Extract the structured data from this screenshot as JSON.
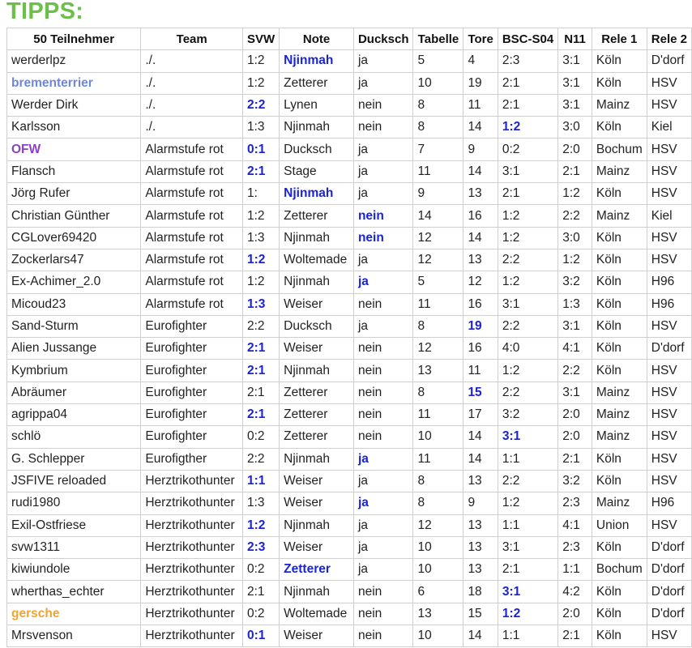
{
  "page": {
    "title": "TIPPS:",
    "title_color": "#6cc04a"
  },
  "highlight_color": "#1a23d6",
  "table": {
    "headers": [
      "50 Teilnehmer",
      "Team",
      "SVW",
      "Note",
      "Ducksch",
      "Tabelle",
      "Tore",
      "BSC-S04",
      "N11",
      "Rele 1",
      "Rele 2"
    ],
    "rows": [
      {
        "cells": [
          "werderlpz",
          "./.",
          "1:2",
          "Njinmah",
          "ja",
          "5",
          "4",
          "2:3",
          "3:1",
          "Köln",
          "D'dorf"
        ],
        "hl": [
          3
        ]
      },
      {
        "cells": [
          "brementerrier",
          "./.",
          "1:2",
          "Zetterer",
          "ja",
          "10",
          "19",
          "2:1",
          "3:1",
          "Köln",
          "HSV"
        ],
        "hl": [],
        "name_color": "#6f86e0",
        "name_bold": true
      },
      {
        "cells": [
          "Werder Dirk",
          "./.",
          "2:2",
          "Lynen",
          "nein",
          "8",
          "11",
          "2:1",
          "3:1",
          "Mainz",
          "HSV"
        ],
        "hl": [
          2
        ]
      },
      {
        "cells": [
          "Karlsson",
          "./.",
          "1:3",
          "Njinmah",
          "nein",
          "8",
          "14",
          "1:2",
          "3:0",
          "Köln",
          "Kiel"
        ],
        "hl": [
          7
        ]
      },
      {
        "cells": [
          "OFW",
          "Alarmstufe rot",
          "0:1",
          "Ducksch",
          "ja",
          "7",
          "9",
          "0:2",
          "2:0",
          "Bochum",
          "HSV"
        ],
        "hl": [
          2
        ],
        "name_color": "#8a3fc7",
        "name_bold": true
      },
      {
        "cells": [
          "Flansch",
          "Alarmstufe rot",
          "2:1",
          "Stage",
          "ja",
          "11",
          "14",
          "3:1",
          "2:1",
          "Mainz",
          "HSV"
        ],
        "hl": [
          2
        ]
      },
      {
        "cells": [
          "Jörg Rufer",
          "Alarmstufe rot",
          "1:",
          "Njinmah",
          "ja",
          "9",
          "13",
          "2:1",
          "1:2",
          "Köln",
          "HSV"
        ],
        "hl": [
          3
        ]
      },
      {
        "cells": [
          "Christian Günther",
          "Alarmstufe rot",
          "1:2",
          "Zetterer",
          "nein",
          "14",
          "16",
          "1:2",
          "2:2",
          "Mainz",
          "Kiel"
        ],
        "hl": [
          4
        ]
      },
      {
        "cells": [
          "CGLover69420",
          "Alarmstufe rot",
          "1:3",
          "Njinmah",
          "nein",
          "12",
          "14",
          "1:2",
          "3:0",
          "Köln",
          "HSV"
        ],
        "hl": [
          4
        ]
      },
      {
        "cells": [
          "Zockerlars47",
          "Alarmstufe rot",
          "1:2",
          "Woltemade",
          "ja",
          "12",
          "13",
          "2:2",
          "1:2",
          "Köln",
          "HSV"
        ],
        "hl": [
          2
        ]
      },
      {
        "cells": [
          "Ex-Achimer_2.0",
          "Alarmstufe rot",
          "1:2",
          "Njinmah",
          "ja",
          "5",
          "12",
          "1:2",
          "3:2",
          "Köln",
          "H96"
        ],
        "hl": [
          4
        ]
      },
      {
        "cells": [
          "Micoud23",
          "Alarmstufe rot",
          "1:3",
          "Weiser",
          "nein",
          "11",
          "16",
          "3:1",
          "1:3",
          "Köln",
          "H96"
        ],
        "hl": [
          2
        ]
      },
      {
        "cells": [
          "Sand-Sturm",
          "Eurofighter",
          "2:2",
          "Ducksch",
          "ja",
          "8",
          "19",
          "2:2",
          "3:1",
          "Köln",
          "HSV"
        ],
        "hl": [
          6
        ]
      },
      {
        "cells": [
          "Alien Jussange",
          "Eurofighter",
          "2:1",
          "Weiser",
          "nein",
          "12",
          "16",
          "4:0",
          "4:1",
          "Köln",
          "D'dorf"
        ],
        "hl": [
          2
        ]
      },
      {
        "cells": [
          "Kymbrium",
          "Eurofighter",
          "2:1",
          "Njinmah",
          "nein",
          "13",
          "11",
          "1:2",
          "2:2",
          "Köln",
          "HSV"
        ],
        "hl": [
          2
        ]
      },
      {
        "cells": [
          "Abräumer",
          "Eurofighter",
          "2:1",
          "Zetterer",
          "nein",
          "8",
          "15",
          "2:2",
          "3:1",
          "Mainz",
          "HSV"
        ],
        "hl": [
          6
        ]
      },
      {
        "cells": [
          "agrippa04",
          "Eurofighter",
          "2:1",
          "Zetterer",
          "nein",
          "11",
          "17",
          "3:2",
          "2:0",
          "Mainz",
          "HSV"
        ],
        "hl": [
          2
        ]
      },
      {
        "cells": [
          "schlö",
          "Eurofighter",
          "0:2",
          "Zetterer",
          "nein",
          "10",
          "14",
          "3:1",
          "2:0",
          "Mainz",
          "HSV"
        ],
        "hl": [
          7
        ]
      },
      {
        "cells": [
          "G. Schlepper",
          "Eurofigther",
          "2:2",
          "Njinmah",
          "ja",
          "11",
          "14",
          "1:1",
          "2:1",
          "Köln",
          "HSV"
        ],
        "hl": [
          4
        ]
      },
      {
        "cells": [
          "JSFIVE reloaded",
          "Herztrikothunter",
          "1:1",
          "Weiser",
          "ja",
          "8",
          "13",
          "2:2",
          "3:2",
          "Köln",
          "HSV"
        ],
        "hl": [
          2
        ]
      },
      {
        "cells": [
          "rudi1980",
          "Herztrikothunter",
          "1:3",
          "Weiser",
          "ja",
          "8",
          "9",
          "1:2",
          "2:3",
          "Mainz",
          "H96"
        ],
        "hl": [
          4
        ]
      },
      {
        "cells": [
          "Exil-Ostfriese",
          "Herztrikothunter",
          "1:2",
          "Njinmah",
          "ja",
          "12",
          "13",
          "1:1",
          "4:1",
          "Union",
          "HSV"
        ],
        "hl": [
          2
        ]
      },
      {
        "cells": [
          "svw1311",
          "Herztrikothunter",
          "2:3",
          "Weiser",
          "ja",
          "10",
          "13",
          "3:1",
          "2:3",
          "Köln",
          "D'dorf"
        ],
        "hl": [
          2
        ]
      },
      {
        "cells": [
          "kiwiundole",
          "Herztrikothunter",
          "0:2",
          "Zetterer",
          "ja",
          "10",
          "13",
          "2:1",
          "1:1",
          "Bochum",
          "D'dorf"
        ],
        "hl": [
          3
        ]
      },
      {
        "cells": [
          "wherthas_echter",
          "Herztrikothunter",
          "2:1",
          "Njinmah",
          "nein",
          "6",
          "18",
          "3:1",
          "4:2",
          "Köln",
          "D'dorf"
        ],
        "hl": [
          7
        ]
      },
      {
        "cells": [
          "gersche",
          "Herztrikothunter",
          "0:2",
          "Woltemade",
          "nein",
          "13",
          "15",
          "1:2",
          "2:0",
          "Köln",
          "D'dorf"
        ],
        "hl": [
          7
        ],
        "name_color": "#f0a531",
        "name_bold": true
      },
      {
        "cells": [
          "Mrsvenson",
          "Herztrikothunter",
          "0:1",
          "Weiser",
          "nein",
          "10",
          "14",
          "1:1",
          "2:1",
          "Köln",
          "HSV"
        ],
        "hl": [
          2
        ]
      }
    ]
  }
}
